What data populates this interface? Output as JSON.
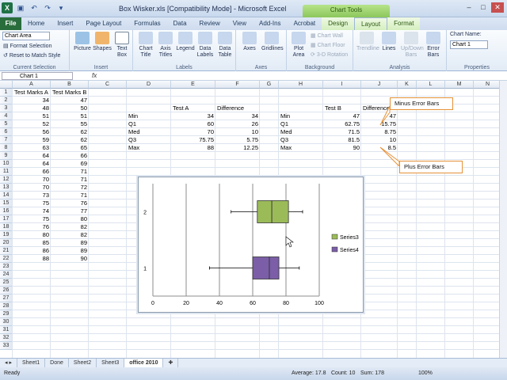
{
  "window": {
    "title": "Box Wisker.xls  [Compatibility Mode] - Microsoft Excel",
    "context_tab_group": "Chart Tools"
  },
  "tabs": [
    {
      "label": "File"
    },
    {
      "label": "Home"
    },
    {
      "label": "Insert"
    },
    {
      "label": "Page Layout"
    },
    {
      "label": "Formulas"
    },
    {
      "label": "Data"
    },
    {
      "label": "Review"
    },
    {
      "label": "View"
    },
    {
      "label": "Add-Ins"
    },
    {
      "label": "Acrobat"
    },
    {
      "label": "Design"
    },
    {
      "label": "Layout"
    },
    {
      "label": "Format"
    }
  ],
  "ribbon": {
    "selection_value": "Chart Area",
    "format_selection": "Format Selection",
    "reset_style": "Reset to Match Style",
    "group_current_selection": "Current Selection",
    "picture": "Picture",
    "shapes": "Shapes",
    "text_box": "Text Box",
    "group_insert": "Insert",
    "chart_title": "Chart Title",
    "axis_titles": "Axis Titles",
    "legend": "Legend",
    "data_labels": "Data Labels",
    "data_table": "Data Table",
    "group_labels": "Labels",
    "axes": "Axes",
    "gridlines": "Gridlines",
    "group_axes": "Axes",
    "plot_area": "Plot Area",
    "chart_wall": "Chart Wall",
    "chart_floor": "Chart Floor",
    "rotation": "3-D Rotation",
    "group_background": "Background",
    "trendline": "Trendline",
    "lines": "Lines",
    "updown_bars": "Up/Down Bars",
    "error_bars": "Error Bars",
    "group_analysis": "Analysis",
    "chart_name_label": "Chart Name:",
    "chart_name_value": "Chart 1",
    "group_properties": "Properties"
  },
  "formula_bar": {
    "name_box": "Chart 1",
    "fx": "fx"
  },
  "columns": [
    "A",
    "B",
    "C",
    "D",
    "E",
    "F",
    "G",
    "H",
    "I",
    "J",
    "K",
    "L",
    "M",
    "N"
  ],
  "rows": [
    "1",
    "2",
    "3",
    "4",
    "5",
    "6",
    "7",
    "8",
    "9",
    "10",
    "11",
    "12",
    "13",
    "14",
    "15",
    "16",
    "17",
    "18",
    "19",
    "20",
    "21",
    "22",
    "23",
    "24",
    "25",
    "26",
    "27",
    "28",
    "29",
    "30",
    "31",
    "32",
    "33"
  ],
  "sheet": {
    "header_a": "Test Marks A",
    "header_b": "Test Marks B",
    "col_a": [
      "34",
      "48",
      "51",
      "52",
      "56",
      "59",
      "63",
      "64",
      "64",
      "66",
      "70",
      "70",
      "73",
      "75",
      "74",
      "75",
      "76",
      "80",
      "85",
      "86",
      "88"
    ],
    "col_b": [
      "47",
      "50",
      "51",
      "55",
      "62",
      "62",
      "65",
      "66",
      "69",
      "71",
      "71",
      "72",
      "71",
      "76",
      "77",
      "80",
      "82",
      "82",
      "89",
      "89",
      "90"
    ],
    "stats_labels": [
      "Min",
      "Q1",
      "Med",
      "Q3",
      "Max"
    ],
    "test_a_header": "Test A",
    "diff_header": "Difference",
    "test_a": [
      "34",
      "60",
      "70",
      "75.75",
      "88"
    ],
    "diff_a": [
      "34",
      "26",
      "10",
      "5.75",
      "12.25"
    ],
    "test_b_header": "Test B",
    "diff_header_b": "Difference",
    "test_b": [
      "47",
      "62.75",
      "71.5",
      "81.5",
      "90"
    ],
    "diff_b": [
      "47",
      "15.75",
      "8.75",
      "10",
      "8.5"
    ]
  },
  "callouts": {
    "minus": "Minus Error Bars",
    "plus": "Plus Error Bars"
  },
  "chart_data": {
    "type": "box",
    "categories": [
      "1",
      "2"
    ],
    "xlim": [
      0,
      100
    ],
    "x_ticks": [
      "0",
      "20",
      "40",
      "60",
      "80",
      "100"
    ],
    "series": [
      {
        "name": "Series4",
        "category": "1",
        "min": 34,
        "q1": 60,
        "median": 70,
        "q3": 75.75,
        "max": 88,
        "color": "#7b5ea7"
      },
      {
        "name": "Series3",
        "category": "2",
        "min": 47,
        "q1": 62.75,
        "median": 71.5,
        "q3": 81.5,
        "max": 90,
        "color": "#9bbb59"
      }
    ],
    "legend": [
      {
        "name": "Series3",
        "color": "#9bbb59"
      },
      {
        "name": "Series4",
        "color": "#7b5ea7"
      }
    ],
    "legend_position": "right",
    "grid": true
  },
  "sheet_tabs": [
    "Sheet1",
    "Done",
    "Sheet2",
    "Sheet3",
    "office 2010"
  ],
  "status": {
    "ready": "Ready",
    "average": "Average: 17.8",
    "count": "Count: 10",
    "sum": "Sum: 178",
    "zoom": "100%"
  }
}
